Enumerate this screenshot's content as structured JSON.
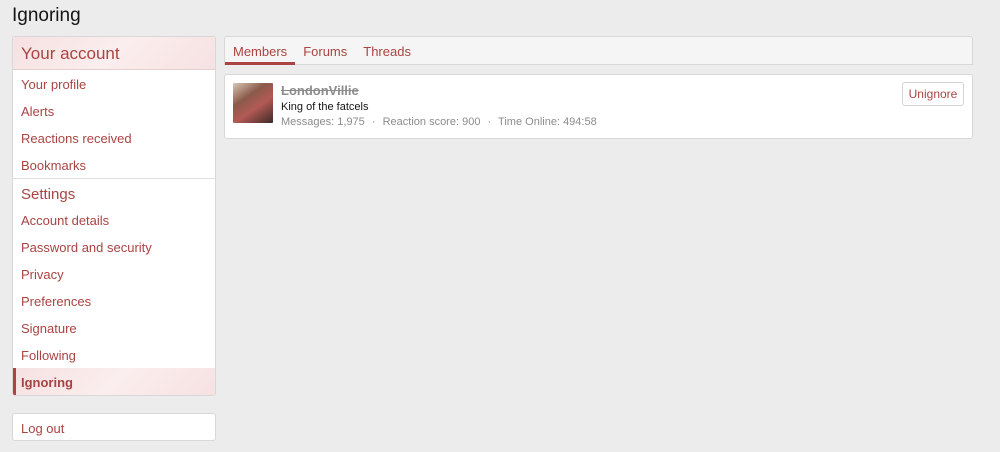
{
  "page": {
    "title": "Ignoring"
  },
  "sidebar": {
    "header": "Your account",
    "items": [
      {
        "label": "Your profile"
      },
      {
        "label": "Alerts"
      },
      {
        "label": "Reactions received"
      },
      {
        "label": "Bookmarks"
      }
    ],
    "settings_header": "Settings",
    "settings_items": [
      {
        "label": "Account details"
      },
      {
        "label": "Password and security"
      },
      {
        "label": "Privacy"
      },
      {
        "label": "Preferences"
      },
      {
        "label": "Signature"
      },
      {
        "label": "Following"
      },
      {
        "label": "Ignoring",
        "active": true
      }
    ],
    "logout": "Log out"
  },
  "tabs": [
    {
      "label": "Members",
      "active": true
    },
    {
      "label": "Forums"
    },
    {
      "label": "Threads"
    }
  ],
  "members": [
    {
      "name": "LondonVillie",
      "title": "King of the fatcels",
      "stats": {
        "messages_label": "Messages:",
        "messages": "1,975",
        "reaction_label": "Reaction score:",
        "reaction": "900",
        "online_label": "Time Online:",
        "online": "494:58"
      },
      "action": "Unignore"
    }
  ],
  "colors": {
    "accent": "#a94442",
    "background": "#ececec",
    "muted": "#8c8c8c"
  }
}
